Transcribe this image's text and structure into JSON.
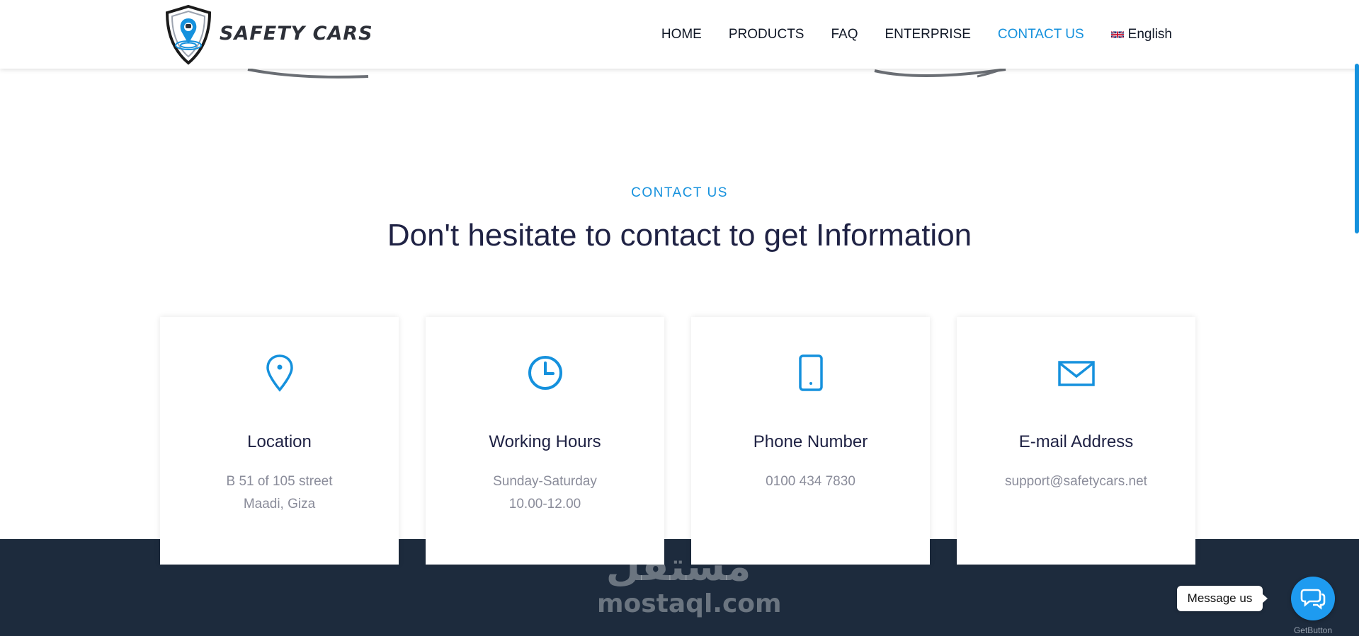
{
  "header": {
    "logo_text": "SAFETY CARS",
    "nav": [
      {
        "label": "HOME"
      },
      {
        "label": "PRODUCTS"
      },
      {
        "label": "FAQ"
      },
      {
        "label": "ENTERPRISE"
      },
      {
        "label": "CONTACT US",
        "active": true
      }
    ],
    "language": "English"
  },
  "section": {
    "eyebrow": "CONTACT US",
    "title": "Don't hesitate to contact to get Information"
  },
  "cards": [
    {
      "icon": "location-pin-icon",
      "title": "Location",
      "line1": "B 51 of 105 street",
      "line2": "Maadi, Giza"
    },
    {
      "icon": "clock-icon",
      "title": "Working Hours",
      "line1": "Sunday-Saturday",
      "line2": "10.00-12.00"
    },
    {
      "icon": "phone-icon",
      "title": "Phone Number",
      "line1": "0100 434 7830",
      "line2": ""
    },
    {
      "icon": "envelope-icon",
      "title": "E-mail Address",
      "line1": "support@safetycars.net",
      "line2": ""
    }
  ],
  "watermark": {
    "arabic": "مستقل",
    "latin": "mostaql.com"
  },
  "chat_widget": {
    "label": "Message us",
    "brand": "GetButton"
  },
  "colors": {
    "accent": "#1591dd",
    "heading": "#1f2244",
    "footer": "#1d2b3d",
    "chat": "#1e9bf0"
  }
}
